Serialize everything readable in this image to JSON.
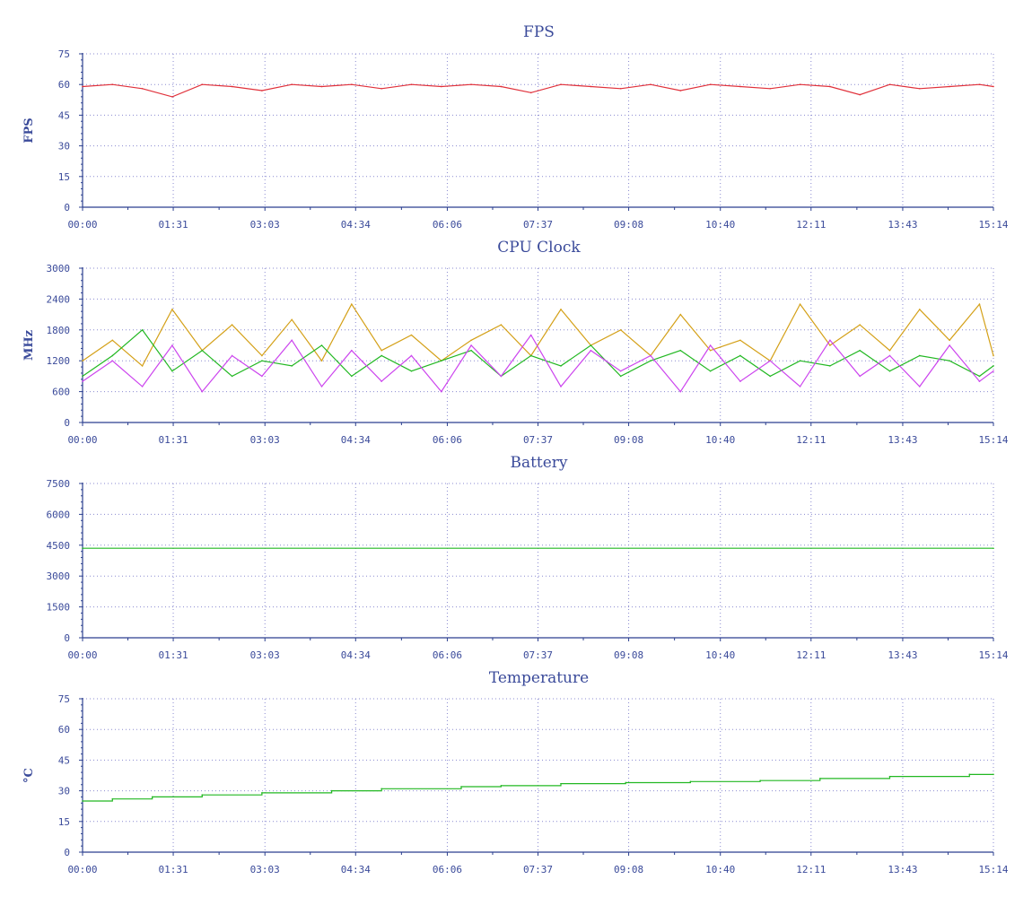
{
  "chart_data": [
    {
      "type": "line",
      "title": "FPS",
      "ylabel": "FPS",
      "ylim": [
        0,
        75
      ],
      "yticks": [
        "0",
        "15",
        "30",
        "45",
        "60",
        "75"
      ],
      "xticks": [
        "00:00",
        "01:31",
        "03:03",
        "04:34",
        "06:06",
        "07:37",
        "09:08",
        "10:40",
        "12:11",
        "13:43",
        "15:14"
      ],
      "grid": true,
      "series": [
        {
          "color": "#e0303a",
          "x": [
            "00:00",
            "00:30",
            "01:00",
            "01:30",
            "02:00",
            "02:30",
            "03:00",
            "03:30",
            "04:00",
            "04:30",
            "05:00",
            "05:30",
            "06:00",
            "06:30",
            "07:00",
            "07:30",
            "08:00",
            "08:30",
            "09:00",
            "09:30",
            "10:00",
            "10:30",
            "11:00",
            "11:30",
            "12:00",
            "12:30",
            "13:00",
            "13:30",
            "14:00",
            "14:30",
            "15:00",
            "15:14"
          ],
          "values": [
            59,
            60,
            58,
            54,
            60,
            59,
            57,
            60,
            59,
            60,
            58,
            60,
            59,
            60,
            59,
            56,
            60,
            59,
            58,
            60,
            57,
            60,
            59,
            58,
            60,
            59,
            55,
            60,
            58,
            59,
            60,
            59
          ]
        }
      ]
    },
    {
      "type": "line",
      "title": "CPU Clock",
      "ylabel": "MHz",
      "ylim": [
        0,
        3000
      ],
      "yticks": [
        "0",
        "600",
        "1200",
        "1800",
        "2400",
        "3000"
      ],
      "xticks": [
        "00:00",
        "01:31",
        "03:03",
        "04:34",
        "06:06",
        "07:37",
        "09:08",
        "10:40",
        "12:11",
        "13:43",
        "15:14"
      ],
      "grid": true,
      "series": [
        {
          "color": "#d4a017",
          "x": [
            "00:00",
            "00:30",
            "01:00",
            "01:30",
            "02:00",
            "02:30",
            "03:00",
            "03:30",
            "04:00",
            "04:30",
            "05:00",
            "05:30",
            "06:00",
            "06:30",
            "07:00",
            "07:30",
            "08:00",
            "08:30",
            "09:00",
            "09:30",
            "10:00",
            "10:30",
            "11:00",
            "11:30",
            "12:00",
            "12:30",
            "13:00",
            "13:30",
            "14:00",
            "14:30",
            "15:00",
            "15:14"
          ],
          "values": [
            1200,
            1600,
            1100,
            2200,
            1400,
            1900,
            1300,
            2000,
            1200,
            2300,
            1400,
            1700,
            1200,
            1600,
            1900,
            1300,
            2200,
            1500,
            1800,
            1300,
            2100,
            1400,
            1600,
            1200,
            2300,
            1500,
            1900,
            1400,
            2200,
            1600,
            2300,
            1300
          ]
        },
        {
          "color": "#22b822",
          "x": [
            "00:00",
            "00:30",
            "01:00",
            "01:30",
            "02:00",
            "02:30",
            "03:00",
            "03:30",
            "04:00",
            "04:30",
            "05:00",
            "05:30",
            "06:00",
            "06:30",
            "07:00",
            "07:30",
            "08:00",
            "08:30",
            "09:00",
            "09:30",
            "10:00",
            "10:30",
            "11:00",
            "11:30",
            "12:00",
            "12:30",
            "13:00",
            "13:30",
            "14:00",
            "14:30",
            "15:00",
            "15:14"
          ],
          "values": [
            900,
            1300,
            1800,
            1000,
            1400,
            900,
            1200,
            1100,
            1500,
            900,
            1300,
            1000,
            1200,
            1400,
            900,
            1300,
            1100,
            1500,
            900,
            1200,
            1400,
            1000,
            1300,
            900,
            1200,
            1100,
            1400,
            1000,
            1300,
            1200,
            900,
            1100
          ]
        },
        {
          "color": "#cc44ee",
          "x": [
            "00:00",
            "00:30",
            "01:00",
            "01:30",
            "02:00",
            "02:30",
            "03:00",
            "03:30",
            "04:00",
            "04:30",
            "05:00",
            "05:30",
            "06:00",
            "06:30",
            "07:00",
            "07:30",
            "08:00",
            "08:30",
            "09:00",
            "09:30",
            "10:00",
            "10:30",
            "11:00",
            "11:30",
            "12:00",
            "12:30",
            "13:00",
            "13:30",
            "14:00",
            "14:30",
            "15:00",
            "15:14"
          ],
          "values": [
            800,
            1200,
            700,
            1500,
            600,
            1300,
            900,
            1600,
            700,
            1400,
            800,
            1300,
            600,
            1500,
            900,
            1700,
            700,
            1400,
            1000,
            1300,
            600,
            1500,
            800,
            1200,
            700,
            1600,
            900,
            1300,
            700,
            1500,
            800,
            1000
          ]
        }
      ]
    },
    {
      "type": "line",
      "title": "Battery",
      "ylabel": "",
      "ylim": [
        0,
        7500
      ],
      "yticks": [
        "0",
        "1500",
        "3000",
        "4500",
        "6000",
        "7500"
      ],
      "xticks": [
        "00:00",
        "01:31",
        "03:03",
        "04:34",
        "06:06",
        "07:37",
        "09:08",
        "10:40",
        "12:11",
        "13:43",
        "15:14"
      ],
      "grid": true,
      "series": [
        {
          "color": "#22b822",
          "x": [
            "00:00",
            "15:14"
          ],
          "values": [
            4350,
            4350
          ]
        }
      ]
    },
    {
      "type": "line",
      "title": "Temperature",
      "ylabel": "°C",
      "ylim": [
        0,
        75
      ],
      "yticks": [
        "0",
        "15",
        "30",
        "45",
        "60",
        "75"
      ],
      "xticks": [
        "00:00",
        "01:31",
        "03:03",
        "04:34",
        "06:06",
        "07:37",
        "09:08",
        "10:40",
        "12:11",
        "13:43",
        "15:14"
      ],
      "grid": true,
      "series": [
        {
          "color": "#22b822",
          "step": true,
          "x": [
            "00:00",
            "00:30",
            "01:10",
            "02:00",
            "03:00",
            "04:10",
            "05:00",
            "06:20",
            "07:00",
            "08:00",
            "09:05",
            "10:10",
            "11:20",
            "12:20",
            "13:30",
            "14:50",
            "15:14"
          ],
          "values": [
            25,
            26,
            27,
            28,
            29,
            30,
            31,
            32,
            32.5,
            33.5,
            34,
            34.5,
            35,
            36,
            37,
            38,
            38
          ]
        }
      ]
    }
  ]
}
